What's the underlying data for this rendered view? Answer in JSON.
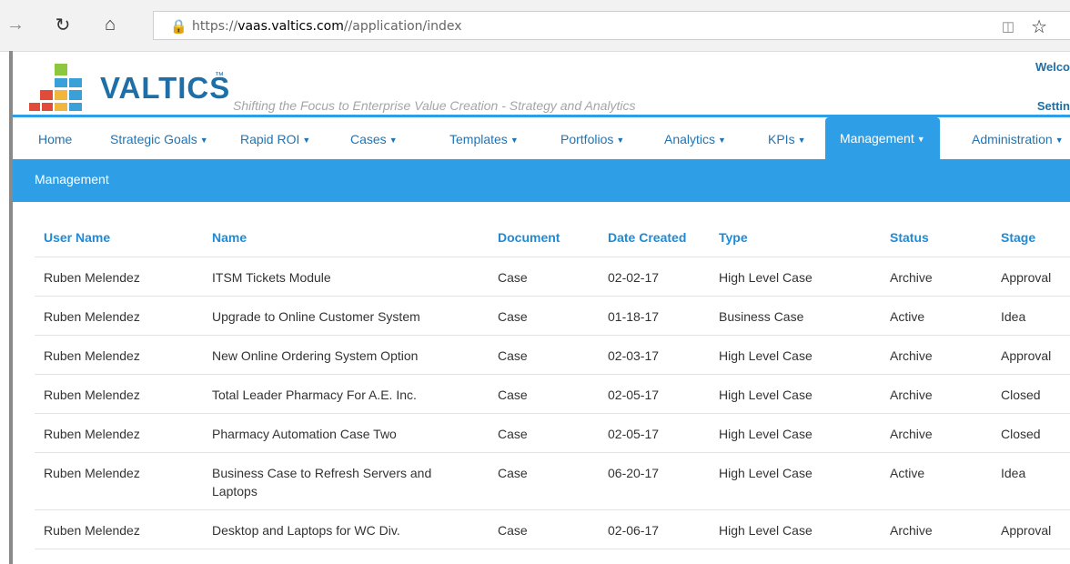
{
  "browser": {
    "url_prefix": "https://",
    "url_host": "vaas.valtics.com",
    "url_path": "//application/index"
  },
  "header": {
    "logo_text": "VALTICS",
    "logo_tm": "™",
    "tagline": "Shifting the Focus to Enterprise Value Creation - Strategy and Analytics",
    "welcome": "Welco",
    "settings": "Settin"
  },
  "nav": {
    "items": [
      {
        "label": "Home",
        "caret": false
      },
      {
        "label": "Strategic Goals",
        "caret": true
      },
      {
        "label": "Rapid ROI",
        "caret": true
      },
      {
        "label": "Cases",
        "caret": true
      },
      {
        "label": "Templates",
        "caret": true
      },
      {
        "label": "Portfolios",
        "caret": true
      },
      {
        "label": "Analytics",
        "caret": true
      },
      {
        "label": "KPIs",
        "caret": true
      },
      {
        "label": "Management",
        "caret": true,
        "active": true
      },
      {
        "label": "Administration",
        "caret": true
      }
    ]
  },
  "section": {
    "title": "Management"
  },
  "table": {
    "columns": [
      "User Name",
      "Name",
      "Document",
      "Date Created",
      "Type",
      "Status",
      "Stage"
    ],
    "rows": [
      [
        "Ruben Melendez",
        "ITSM Tickets Module",
        "Case",
        "02-02-17",
        "High Level Case",
        "Archive",
        "Approval"
      ],
      [
        "Ruben Melendez",
        "Upgrade to Online Customer System",
        "Case",
        "01-18-17",
        "Business Case",
        "Active",
        "Idea"
      ],
      [
        "Ruben Melendez",
        "New Online Ordering System Option",
        "Case",
        "02-03-17",
        "High Level Case",
        "Archive",
        "Approval"
      ],
      [
        "Ruben Melendez",
        "Total Leader Pharmacy For A.E. Inc.",
        "Case",
        "02-05-17",
        "High Level Case",
        "Archive",
        "Closed"
      ],
      [
        "Ruben Melendez",
        "Pharmacy Automation Case Two",
        "Case",
        "02-05-17",
        "High Level Case",
        "Archive",
        "Closed"
      ],
      [
        "Ruben Melendez",
        "Business Case to Refresh Servers and Laptops",
        "Case",
        "06-20-17",
        "High Level Case",
        "Active",
        "Idea"
      ],
      [
        "Ruben Melendez",
        "Desktop and Laptops for WC Div.",
        "Case",
        "02-06-17",
        "High Level Case",
        "Archive",
        "Approval"
      ]
    ]
  }
}
